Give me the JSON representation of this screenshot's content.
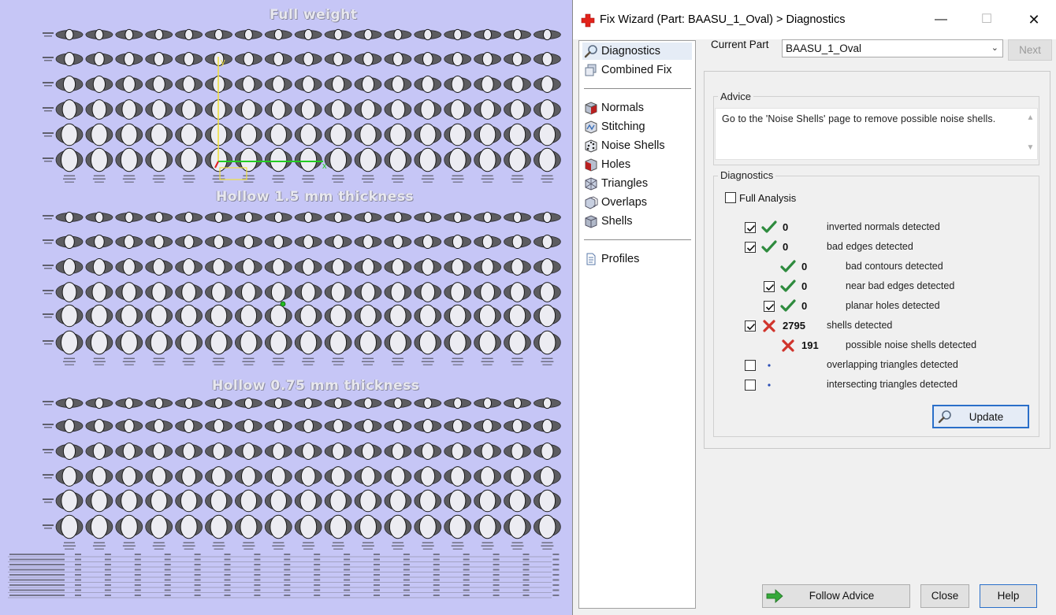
{
  "viewport": {
    "section_titles": [
      "Full weight",
      "Hollow 1.5 mm thickness",
      "Hollow 0.75 mm thickness"
    ],
    "axis_x_label": "x",
    "axis_y_label": "y",
    "axis_colors": {
      "x": "#22cc22",
      "y": "#f0e040",
      "origin": "#e02020"
    },
    "background": "#c6c6f6"
  },
  "dialog": {
    "title": "Fix Wizard (Part: BAASU_1_Oval) > Diagnostics",
    "window_buttons": {
      "minimize": "—",
      "maximize": "☐",
      "close": "✕"
    },
    "nav": {
      "items": [
        {
          "label": "Diagnostics",
          "icon": "magnifier-icon",
          "selected": true
        },
        {
          "label": "Combined Fix",
          "icon": "cube-stack-icon"
        },
        {
          "label": "Normals",
          "icon": "cube-red-icon"
        },
        {
          "label": "Stitching",
          "icon": "stitching-icon"
        },
        {
          "label": "Noise Shells",
          "icon": "dice-icon"
        },
        {
          "label": "Holes",
          "icon": "cube-hole-icon"
        },
        {
          "label": "Triangles",
          "icon": "triangle-mesh-icon"
        },
        {
          "label": "Overlaps",
          "icon": "overlap-icon"
        },
        {
          "label": "Shells",
          "icon": "shell-icon"
        },
        {
          "label": "Profiles",
          "icon": "document-icon"
        }
      ]
    },
    "current_part_label": "Current Part",
    "current_part_value": "BAASU_1_Oval",
    "next_label": "Next",
    "advice": {
      "legend": "Advice",
      "text": "Go to the 'Noise Shells' page to remove possible noise shells."
    },
    "diagnostics": {
      "legend": "Diagnostics",
      "full_analysis_label": "Full Analysis",
      "full_analysis_checked": false,
      "rows": [
        {
          "checkbox": true,
          "checked": true,
          "status": "ok",
          "count": "0",
          "label": "inverted normals detected",
          "indent": 0
        },
        {
          "checkbox": true,
          "checked": true,
          "status": "ok",
          "count": "0",
          "label": "bad edges detected",
          "indent": 0
        },
        {
          "checkbox": false,
          "checked": false,
          "status": "ok",
          "count": "0",
          "label": "bad contours detected",
          "indent": 1
        },
        {
          "checkbox": true,
          "checked": true,
          "status": "ok",
          "count": "0",
          "label": "near bad edges detected",
          "indent": 1
        },
        {
          "checkbox": true,
          "checked": true,
          "status": "ok",
          "count": "0",
          "label": "planar holes detected",
          "indent": 1
        },
        {
          "checkbox": true,
          "checked": true,
          "status": "error",
          "count": "2795",
          "label": "shells detected",
          "indent": 0
        },
        {
          "checkbox": false,
          "checked": false,
          "status": "error",
          "count": "191",
          "label": "possible noise shells detected",
          "indent": 1
        },
        {
          "checkbox": true,
          "checked": false,
          "status": "none",
          "count": "",
          "label": "overlapping triangles detected",
          "indent": 0
        },
        {
          "checkbox": true,
          "checked": false,
          "status": "none",
          "count": "",
          "label": "intersecting triangles detected",
          "indent": 0
        }
      ],
      "status_colors": {
        "ok": "#2e8b3e",
        "error": "#d0342c",
        "none": "#2a4db5"
      }
    },
    "update_label": "Update",
    "follow_advice_label": "Follow Advice",
    "close_label": "Close",
    "help_label": "Help"
  }
}
